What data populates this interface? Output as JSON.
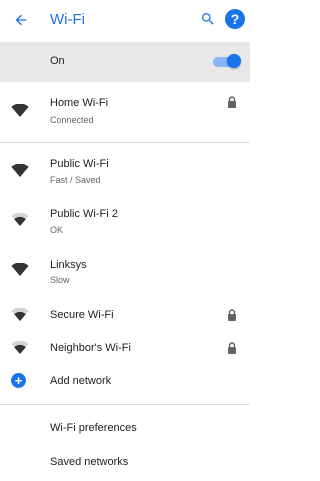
{
  "header": {
    "title": "Wi-Fi",
    "back_icon": "arrow-back-icon",
    "search_icon": "search-icon",
    "help_icon": "help-icon",
    "help_glyph": "?",
    "accent": "#1a73e8"
  },
  "master": {
    "label": "On",
    "enabled": true
  },
  "connected": {
    "name": "Home Wi-Fi",
    "status": "Connected",
    "secured": true,
    "signal": "full"
  },
  "networks": [
    {
      "name": "Public Wi-Fi",
      "status": "Fast / Saved",
      "secured": false,
      "signal": "full"
    },
    {
      "name": "Public Wi-Fi 2",
      "status": "OK",
      "secured": false,
      "signal": "medium"
    },
    {
      "name": "Linksys",
      "status": "Slow",
      "secured": false,
      "signal": "full"
    },
    {
      "name": "Secure Wi-Fi",
      "status": "",
      "secured": true,
      "signal": "medium"
    },
    {
      "name": "Neighbor's Wi-Fi",
      "status": "",
      "secured": true,
      "signal": "medium"
    }
  ],
  "add_network": {
    "label": "Add network",
    "icon": "add-circle-icon",
    "glyph": "+"
  },
  "footer_items": [
    {
      "label": "Wi-Fi preferences"
    },
    {
      "label": "Saved networks"
    }
  ]
}
